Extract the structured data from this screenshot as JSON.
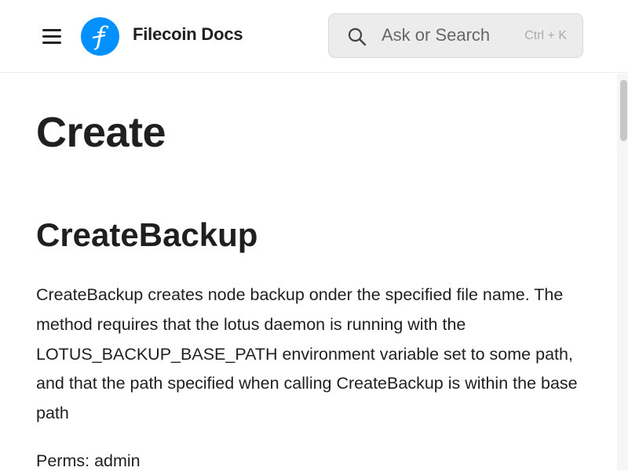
{
  "header": {
    "site_title": "Filecoin Docs",
    "logo_glyph": "f",
    "brand_color": "#0090ff",
    "menu_icon": "hamburger-menu-icon",
    "search": {
      "placeholder": "Ask or Search",
      "shortcut": "Ctrl + K",
      "icon": "search-icon"
    }
  },
  "main": {
    "page_title": "Create",
    "section_title": "CreateBackup",
    "description": "CreateBackup creates node backup onder the specified file name. The method requires that the lotus daemon is running with the LOTUS_BACKUP_BASE_PATH environment variable set to some path, and that the path specified when calling CreateBackup is within the base path",
    "perms": "Perms: admin"
  }
}
